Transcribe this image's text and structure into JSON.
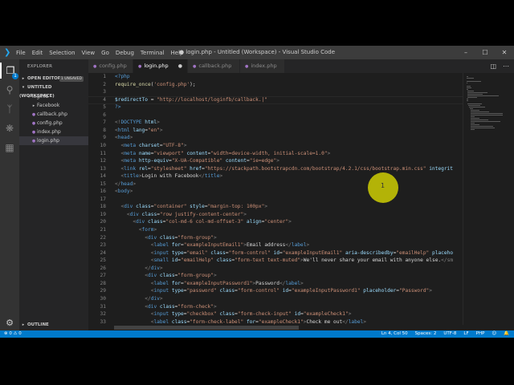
{
  "window": {
    "title": "● login.php - Untitled (Workspace) - Visual Studio Code",
    "menu": [
      "File",
      "Edit",
      "Selection",
      "View",
      "Go",
      "Debug",
      "Terminal",
      "Help"
    ],
    "controls": [
      "–",
      "☐",
      "✕"
    ]
  },
  "activity_bar": {
    "explorer_badge": "1",
    "icons": [
      "files-icon",
      "search-icon",
      "source-control-icon",
      "debug-icon",
      "extensions-icon",
      "gear-icon"
    ]
  },
  "sidebar": {
    "header": "EXPLORER",
    "open_editors": "OPEN EDITORS",
    "unsaved_badge": "1 UNSAVED",
    "workspace": "UNTITLED (WORKSPACE)",
    "folder": "loginfb",
    "items": [
      {
        "label": "Facebook",
        "kind": "folder"
      },
      {
        "label": "callback.php",
        "kind": "php"
      },
      {
        "label": "config.php",
        "kind": "php"
      },
      {
        "label": "index.php",
        "kind": "php"
      },
      {
        "label": "login.php",
        "kind": "php"
      }
    ],
    "outline": "OUTLINE"
  },
  "tabs": [
    {
      "label": "config.php",
      "active": false
    },
    {
      "label": "login.php",
      "active": true,
      "dirty": true
    },
    {
      "label": "callback.php",
      "active": false
    },
    {
      "label": "index.php",
      "active": false
    }
  ],
  "editor": {
    "lines": [
      {
        "n": "1",
        "tokens": [
          [
            "t-php",
            "<?php"
          ]
        ]
      },
      {
        "n": "2",
        "tokens": [
          [
            "t-fn",
            "require_once"
          ],
          [
            "t-txt",
            "("
          ],
          [
            "t-str",
            "'config.php'"
          ],
          [
            "t-txt",
            ");"
          ]
        ]
      },
      {
        "n": "3",
        "tokens": []
      },
      {
        "n": "4",
        "tokens": [
          [
            "t-var",
            "$redirectTo"
          ],
          [
            "t-txt",
            " = "
          ],
          [
            "t-str",
            "\"http://localhost/loginfb/callback.|\""
          ]
        ]
      },
      {
        "n": "5",
        "tokens": [
          [
            "t-php",
            "?>"
          ]
        ]
      },
      {
        "n": "6",
        "tokens": []
      },
      {
        "n": "7",
        "tokens": [
          [
            "t-tag",
            "<!"
          ],
          [
            "t-doc",
            "DOCTYPE"
          ],
          [
            "t-attr",
            " html"
          ],
          [
            "t-tag",
            ">"
          ]
        ]
      },
      {
        "n": "8",
        "tokens": [
          [
            "t-tag",
            "<"
          ],
          [
            "t-name",
            "html"
          ],
          [
            "t-attr",
            " lang"
          ],
          [
            "t-txt",
            "="
          ],
          [
            "t-str",
            "\"en\""
          ],
          [
            "t-tag",
            ">"
          ]
        ]
      },
      {
        "n": "9",
        "tokens": [
          [
            "t-tag",
            "<"
          ],
          [
            "t-name",
            "head"
          ],
          [
            "t-tag",
            ">"
          ]
        ]
      },
      {
        "n": "10",
        "tokens": [
          [
            "t-txt",
            "  "
          ],
          [
            "t-tag",
            "<"
          ],
          [
            "t-name",
            "meta"
          ],
          [
            "t-attr",
            " charset"
          ],
          [
            "t-txt",
            "="
          ],
          [
            "t-str",
            "\"UTF-8\""
          ],
          [
            "t-tag",
            ">"
          ]
        ]
      },
      {
        "n": "11",
        "tokens": [
          [
            "t-txt",
            "  "
          ],
          [
            "t-tag",
            "<"
          ],
          [
            "t-name",
            "meta"
          ],
          [
            "t-attr",
            " name"
          ],
          [
            "t-txt",
            "="
          ],
          [
            "t-str",
            "\"viewport\""
          ],
          [
            "t-attr",
            " content"
          ],
          [
            "t-txt",
            "="
          ],
          [
            "t-str",
            "\"width=device-width, initial-scale=1.0\""
          ],
          [
            "t-tag",
            ">"
          ]
        ]
      },
      {
        "n": "12",
        "tokens": [
          [
            "t-txt",
            "  "
          ],
          [
            "t-tag",
            "<"
          ],
          [
            "t-name",
            "meta"
          ],
          [
            "t-attr",
            " http-equiv"
          ],
          [
            "t-txt",
            "="
          ],
          [
            "t-str",
            "\"X-UA-Compatible\""
          ],
          [
            "t-attr",
            " content"
          ],
          [
            "t-txt",
            "="
          ],
          [
            "t-str",
            "\"ie=edge\""
          ],
          [
            "t-tag",
            ">"
          ]
        ]
      },
      {
        "n": "13",
        "tokens": [
          [
            "t-txt",
            "  "
          ],
          [
            "t-tag",
            "<"
          ],
          [
            "t-name",
            "link"
          ],
          [
            "t-attr",
            " rel"
          ],
          [
            "t-txt",
            "="
          ],
          [
            "t-str",
            "\"stylesheet\""
          ],
          [
            "t-attr",
            " href"
          ],
          [
            "t-txt",
            "="
          ],
          [
            "t-str",
            "\"https://stackpath.bootstrapcdn.com/bootstrap/4.2.1/css/bootstrap.min.css\""
          ],
          [
            "t-attr",
            " integrit"
          ]
        ]
      },
      {
        "n": "14",
        "tokens": [
          [
            "t-txt",
            "  "
          ],
          [
            "t-tag",
            "<"
          ],
          [
            "t-name",
            "title"
          ],
          [
            "t-tag",
            ">"
          ],
          [
            "t-txt",
            "Login with Facebook"
          ],
          [
            "t-tag",
            "</"
          ],
          [
            "t-name",
            "title"
          ],
          [
            "t-tag",
            ">"
          ]
        ]
      },
      {
        "n": "15",
        "tokens": [
          [
            "t-tag",
            "</"
          ],
          [
            "t-name",
            "head"
          ],
          [
            "t-tag",
            ">"
          ]
        ]
      },
      {
        "n": "16",
        "tokens": [
          [
            "t-tag",
            "<"
          ],
          [
            "t-name",
            "body"
          ],
          [
            "t-tag",
            ">"
          ]
        ]
      },
      {
        "n": "17",
        "tokens": []
      },
      {
        "n": "18",
        "tokens": [
          [
            "t-txt",
            "  "
          ],
          [
            "t-tag",
            "<"
          ],
          [
            "t-name",
            "div"
          ],
          [
            "t-attr",
            " class"
          ],
          [
            "t-txt",
            "="
          ],
          [
            "t-str",
            "\"container\""
          ],
          [
            "t-attr",
            " style"
          ],
          [
            "t-txt",
            "="
          ],
          [
            "t-str",
            "\"margin-top: 100px\""
          ],
          [
            "t-tag",
            ">"
          ]
        ]
      },
      {
        "n": "19",
        "tokens": [
          [
            "t-txt",
            "    "
          ],
          [
            "t-tag",
            "<"
          ],
          [
            "t-name",
            "div"
          ],
          [
            "t-attr",
            " class"
          ],
          [
            "t-txt",
            "="
          ],
          [
            "t-str",
            "\"row justify-content-center\""
          ],
          [
            "t-tag",
            ">"
          ]
        ]
      },
      {
        "n": "20",
        "tokens": [
          [
            "t-txt",
            "      "
          ],
          [
            "t-tag",
            "<"
          ],
          [
            "t-name",
            "div"
          ],
          [
            "t-attr",
            " class"
          ],
          [
            "t-txt",
            "="
          ],
          [
            "t-str",
            "\"col-md-6 col-md-offset-3\""
          ],
          [
            "t-attr",
            " align"
          ],
          [
            "t-txt",
            "="
          ],
          [
            "t-str",
            "\"center\""
          ],
          [
            "t-tag",
            ">"
          ]
        ]
      },
      {
        "n": "21",
        "tokens": [
          [
            "t-txt",
            "        "
          ],
          [
            "t-tag",
            "<"
          ],
          [
            "t-name",
            "form"
          ],
          [
            "t-tag",
            ">"
          ]
        ]
      },
      {
        "n": "22",
        "tokens": [
          [
            "t-txt",
            "          "
          ],
          [
            "t-tag",
            "<"
          ],
          [
            "t-name",
            "div"
          ],
          [
            "t-attr",
            " class"
          ],
          [
            "t-txt",
            "="
          ],
          [
            "t-str",
            "\"form-group\""
          ],
          [
            "t-tag",
            ">"
          ]
        ]
      },
      {
        "n": "23",
        "tokens": [
          [
            "t-txt",
            "            "
          ],
          [
            "t-tag",
            "<"
          ],
          [
            "t-name",
            "label"
          ],
          [
            "t-attr",
            " for"
          ],
          [
            "t-txt",
            "="
          ],
          [
            "t-str",
            "\"exampleInputEmail1\""
          ],
          [
            "t-tag",
            ">"
          ],
          [
            "t-txt",
            "Email address"
          ],
          [
            "t-tag",
            "</"
          ],
          [
            "t-name",
            "label"
          ],
          [
            "t-tag",
            ">"
          ]
        ]
      },
      {
        "n": "24",
        "tokens": [
          [
            "t-txt",
            "            "
          ],
          [
            "t-tag",
            "<"
          ],
          [
            "t-name",
            "input"
          ],
          [
            "t-attr",
            " type"
          ],
          [
            "t-txt",
            "="
          ],
          [
            "t-str",
            "\"email\""
          ],
          [
            "t-attr",
            " class"
          ],
          [
            "t-txt",
            "="
          ],
          [
            "t-str",
            "\"form-control\""
          ],
          [
            "t-attr",
            " id"
          ],
          [
            "t-txt",
            "="
          ],
          [
            "t-str",
            "\"exampleInputEmail1\""
          ],
          [
            "t-attr",
            " aria-describedby"
          ],
          [
            "t-txt",
            "="
          ],
          [
            "t-str",
            "\"emailHelp\""
          ],
          [
            "t-attr",
            " placeho"
          ]
        ]
      },
      {
        "n": "25",
        "tokens": [
          [
            "t-txt",
            "            "
          ],
          [
            "t-tag",
            "<"
          ],
          [
            "t-name",
            "small"
          ],
          [
            "t-attr",
            " id"
          ],
          [
            "t-txt",
            "="
          ],
          [
            "t-str",
            "\"emailHelp\""
          ],
          [
            "t-attr",
            " class"
          ],
          [
            "t-txt",
            "="
          ],
          [
            "t-str",
            "\"form-text text-muted\""
          ],
          [
            "t-tag",
            ">"
          ],
          [
            "t-txt",
            "We'll never share your email with anyone else."
          ],
          [
            "t-tag",
            "</sm"
          ]
        ]
      },
      {
        "n": "26",
        "tokens": [
          [
            "t-txt",
            "          "
          ],
          [
            "t-tag",
            "</"
          ],
          [
            "t-name",
            "div"
          ],
          [
            "t-tag",
            ">"
          ]
        ]
      },
      {
        "n": "27",
        "tokens": [
          [
            "t-txt",
            "          "
          ],
          [
            "t-tag",
            "<"
          ],
          [
            "t-name",
            "div"
          ],
          [
            "t-attr",
            " class"
          ],
          [
            "t-txt",
            "="
          ],
          [
            "t-str",
            "\"form-group\""
          ],
          [
            "t-tag",
            ">"
          ]
        ]
      },
      {
        "n": "28",
        "tokens": [
          [
            "t-txt",
            "            "
          ],
          [
            "t-tag",
            "<"
          ],
          [
            "t-name",
            "label"
          ],
          [
            "t-attr",
            " for"
          ],
          [
            "t-txt",
            "="
          ],
          [
            "t-str",
            "\"exampleInputPassword1\""
          ],
          [
            "t-tag",
            ">"
          ],
          [
            "t-txt",
            "Password"
          ],
          [
            "t-tag",
            "</"
          ],
          [
            "t-name",
            "label"
          ],
          [
            "t-tag",
            ">"
          ]
        ]
      },
      {
        "n": "29",
        "tokens": [
          [
            "t-txt",
            "            "
          ],
          [
            "t-tag",
            "<"
          ],
          [
            "t-name",
            "input"
          ],
          [
            "t-attr",
            " type"
          ],
          [
            "t-txt",
            "="
          ],
          [
            "t-str",
            "\"password\""
          ],
          [
            "t-attr",
            " class"
          ],
          [
            "t-txt",
            "="
          ],
          [
            "t-str",
            "\"form-control\""
          ],
          [
            "t-attr",
            " id"
          ],
          [
            "t-txt",
            "="
          ],
          [
            "t-str",
            "\"exampleInputPassword1\""
          ],
          [
            "t-attr",
            " placeholder"
          ],
          [
            "t-txt",
            "="
          ],
          [
            "t-str",
            "\"Password\""
          ],
          [
            "t-tag",
            ">"
          ]
        ]
      },
      {
        "n": "30",
        "tokens": [
          [
            "t-txt",
            "          "
          ],
          [
            "t-tag",
            "</"
          ],
          [
            "t-name",
            "div"
          ],
          [
            "t-tag",
            ">"
          ]
        ]
      },
      {
        "n": "31",
        "tokens": [
          [
            "t-txt",
            "          "
          ],
          [
            "t-tag",
            "<"
          ],
          [
            "t-name",
            "div"
          ],
          [
            "t-attr",
            " class"
          ],
          [
            "t-txt",
            "="
          ],
          [
            "t-str",
            "\"form-check\""
          ],
          [
            "t-tag",
            ">"
          ]
        ]
      },
      {
        "n": "32",
        "tokens": [
          [
            "t-txt",
            "            "
          ],
          [
            "t-tag",
            "<"
          ],
          [
            "t-name",
            "input"
          ],
          [
            "t-attr",
            " type"
          ],
          [
            "t-txt",
            "="
          ],
          [
            "t-str",
            "\"checkbox\""
          ],
          [
            "t-attr",
            " class"
          ],
          [
            "t-txt",
            "="
          ],
          [
            "t-str",
            "\"form-check-input\""
          ],
          [
            "t-attr",
            " id"
          ],
          [
            "t-txt",
            "="
          ],
          [
            "t-str",
            "\"exampleCheck1\""
          ],
          [
            "t-tag",
            ">"
          ]
        ]
      },
      {
        "n": "33",
        "tokens": [
          [
            "t-txt",
            "            "
          ],
          [
            "t-tag",
            "<"
          ],
          [
            "t-name",
            "label"
          ],
          [
            "t-attr",
            " class"
          ],
          [
            "t-txt",
            "="
          ],
          [
            "t-str",
            "\"form-check-label\""
          ],
          [
            "t-attr",
            " for"
          ],
          [
            "t-txt",
            "="
          ],
          [
            "t-str",
            "\"exampleCheck1\""
          ],
          [
            "t-tag",
            ">"
          ],
          [
            "t-txt",
            "Check me out"
          ],
          [
            "t-tag",
            "</"
          ],
          [
            "t-name",
            "label"
          ],
          [
            "t-tag",
            ">"
          ]
        ]
      },
      {
        "n": "34",
        "tokens": [
          [
            "t-txt",
            "          "
          ],
          [
            "t-tag",
            "</"
          ],
          [
            "t-name",
            "div"
          ],
          [
            "t-tag",
            ">"
          ]
        ]
      }
    ],
    "pointer_label": "1"
  },
  "statusbar": {
    "left": "⊗ 0  ⚠ 0",
    "right": [
      "Ln 4, Col 50",
      "Spaces: 2",
      "UTF-8",
      "LF",
      "PHP",
      "☺",
      "🔔"
    ]
  },
  "colors": {
    "accent": "#007acc",
    "background": "#1e1e1e",
    "sidebar": "#252526",
    "titlebar": "#3c3c3c"
  }
}
